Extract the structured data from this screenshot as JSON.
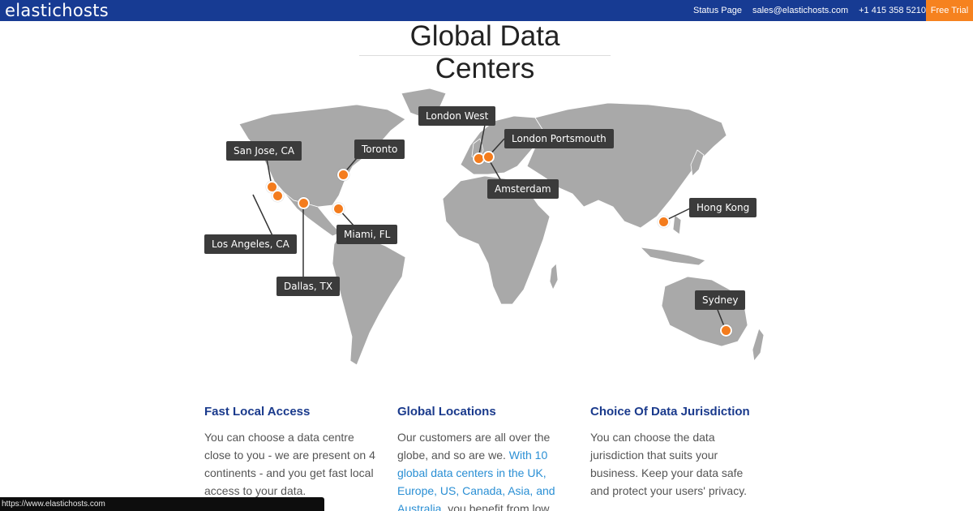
{
  "header": {
    "logo": "elastichosts",
    "nav": [
      "Status Page",
      "sales@elastichosts.com",
      "+1 415 358 5210"
    ],
    "cta": "Free Trial"
  },
  "colors": {
    "header_bg": "#173b93",
    "cta_bg": "#f6821f",
    "pin": "#f47c1d",
    "heading": "#1a3a8c",
    "link": "#2a8fd4"
  },
  "title": "Global Data Centers",
  "map": {
    "locations": [
      "San Jose, CA",
      "Toronto",
      "London West",
      "London Portsmouth",
      "Amsterdam",
      "Hong Kong",
      "Los Angeles, CA",
      "Miami, FL",
      "Dallas, TX",
      "Sydney"
    ]
  },
  "features": [
    {
      "heading": "Fast Local Access",
      "body": "You can choose a data centre close to you - we are present on 4 continents - and you get fast local access to your data."
    },
    {
      "heading": "Global Locations",
      "body_pre": "Our customers are all over the globe, and so are we. ",
      "body_link": "With 10 global data centers in the UK, Europe, US, Canada, Asia, and Australia",
      "body_post": ", you benefit from low latency and"
    },
    {
      "heading": "Choice Of Data Jurisdiction",
      "body": "You can choose the data jurisdiction that suits your business. Keep your data safe and protect your users' privacy."
    }
  ],
  "status_url": "https://www.elastichosts.com"
}
